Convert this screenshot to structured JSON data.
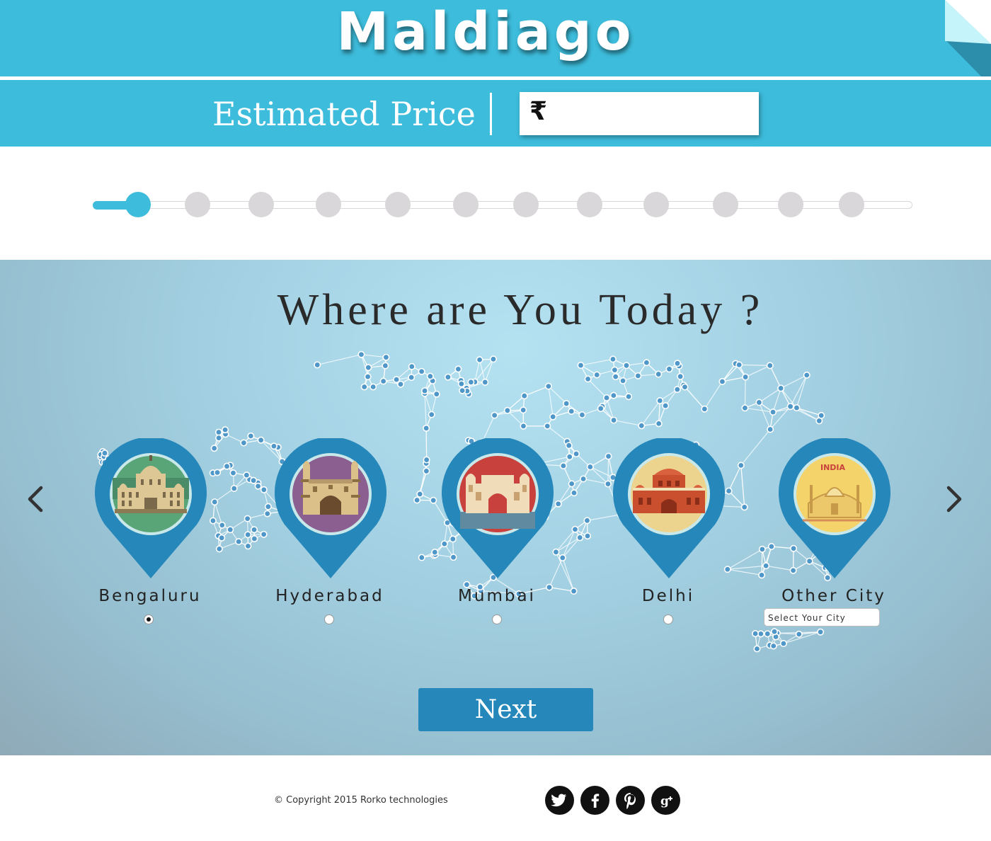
{
  "header": {
    "brand": "Maldiago",
    "price_label": "Estimated Price",
    "currency_symbol": "₹",
    "price_value": ""
  },
  "progress": {
    "total_steps": 12,
    "current_step": 1
  },
  "main": {
    "title": "Where are You Today ?",
    "cities": [
      {
        "label": "Bengaluru",
        "selected": true
      },
      {
        "label": "Hyderabad",
        "selected": false
      },
      {
        "label": "Mumbai",
        "selected": false
      },
      {
        "label": "Delhi",
        "selected": false
      },
      {
        "label": "Other City",
        "placeholder": "Select Your City",
        "badge": "INDIA"
      }
    ],
    "next_label": "Next"
  },
  "footer": {
    "copyright": "© Copyright 2015 Rorko technologies",
    "social": [
      "twitter-icon",
      "facebook-icon",
      "pinterest-icon",
      "google-plus-icon"
    ]
  },
  "colors": {
    "accent": "#3dbcdb",
    "pin": "#2587ba",
    "button": "#2587ba",
    "text": "#2a2a2a"
  }
}
